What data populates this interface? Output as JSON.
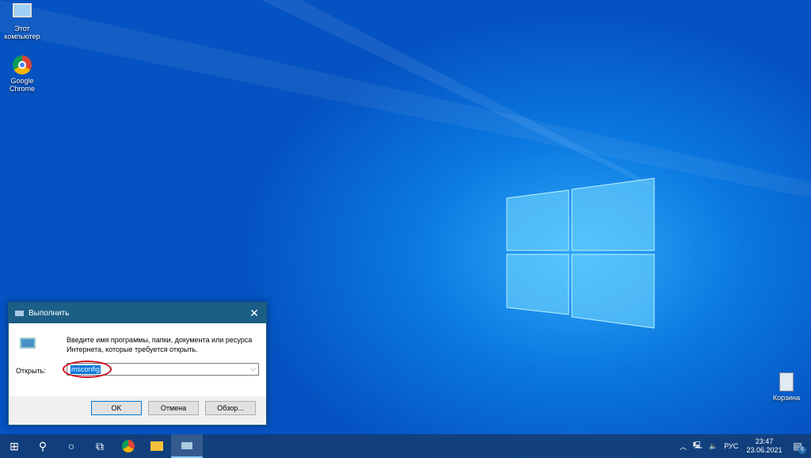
{
  "desktop": {
    "icons": [
      {
        "label": "Этот компьютер"
      },
      {
        "label": "Google Chrome"
      },
      {
        "label": "Корзина"
      }
    ]
  },
  "run_dialog": {
    "title": "Выполнить",
    "description_line1": "Введите имя программы, папки, документа или ресурса",
    "description_line2": "Интернета, которые требуется открыть.",
    "open_label": "Открыть:",
    "input_value": "msconfig",
    "ok": "OK",
    "cancel": "Отмена",
    "browse": "Обзор..."
  },
  "taskbar": {
    "language": "РУС",
    "time": "23:47",
    "date": "23.06.2021",
    "notification_count": "6"
  },
  "colors": {
    "accent": "#0078d7",
    "annotation": "#d01020"
  }
}
